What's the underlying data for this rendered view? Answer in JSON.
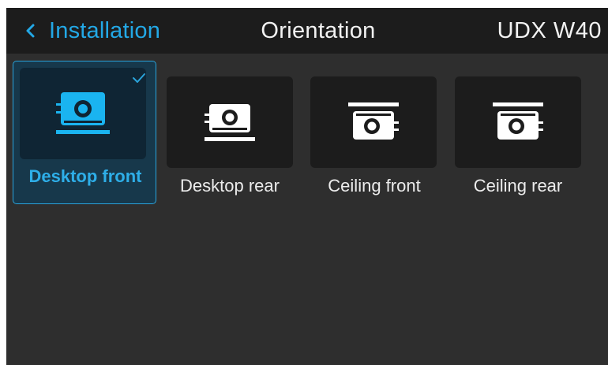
{
  "header": {
    "back_label": "Installation",
    "title": "Orientation",
    "model": "UDX W40"
  },
  "options": [
    {
      "label": "Desktop front",
      "icon": "projector-desktop-icon",
      "selected": true
    },
    {
      "label": "Desktop rear",
      "icon": "projector-desktop-icon",
      "selected": false
    },
    {
      "label": "Ceiling front",
      "icon": "projector-ceiling-icon",
      "selected": false
    },
    {
      "label": "Ceiling rear",
      "icon": "projector-ceiling-icon",
      "selected": false
    }
  ],
  "colors": {
    "accent": "#23a8e6",
    "header_bg": "#1c1c1c",
    "screen_bg": "#2e2e2e",
    "tile_bg": "#1c1c1c",
    "selected_bg": "#17384b",
    "text": "#f2f2f2"
  }
}
